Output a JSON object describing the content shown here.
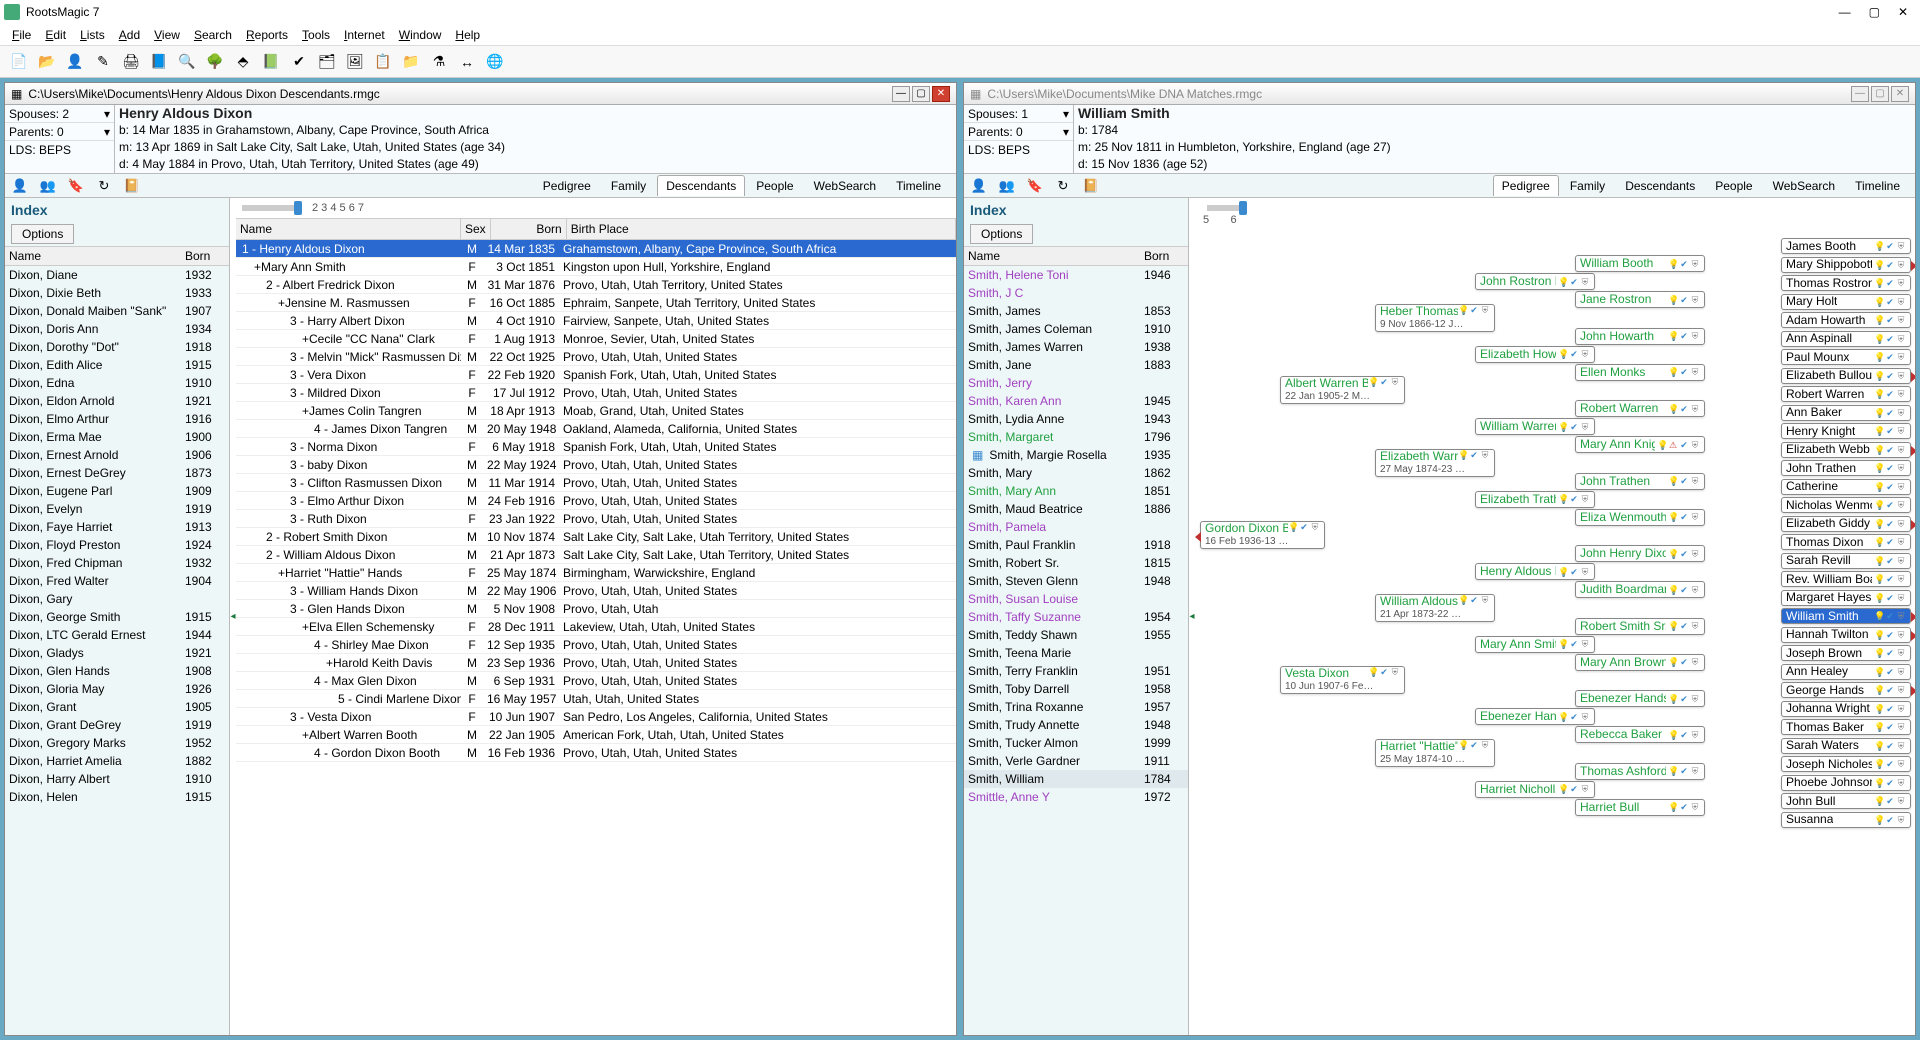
{
  "app": {
    "title": "RootsMagic 7"
  },
  "menu": [
    "File",
    "Edit",
    "Lists",
    "Add",
    "View",
    "Search",
    "Reports",
    "Tools",
    "Internet",
    "Window",
    "Help"
  ],
  "windows": [
    {
      "path": "C:\\Users\\Mike\\Documents\\Henry Aldous Dixon Descendants.rmgc",
      "active": true,
      "spouses": "Spouses: 2",
      "parents": "Parents: 0",
      "lds": "LDS: BEPS",
      "person": {
        "name": "Henry Aldous Dixon",
        "birth": "b: 14 Mar 1835 in Grahamstown, Albany, Cape Province, South Africa",
        "marriage": "m: 13 Apr 1869 in Salt Lake City, Salt Lake, Utah, United States (age 34)",
        "death": "d: 4 May 1884 in Provo, Utah, Utah Territory, United States (age 49)"
      },
      "tabs": [
        "Pedigree",
        "Family",
        "Descendants",
        "People",
        "WebSearch",
        "Timeline"
      ],
      "activeTab": "Descendants",
      "gens": "2  3  4  5  6  7",
      "indexCols": [
        "Name",
        "Born"
      ],
      "index": [
        [
          "Dixon, Diane",
          "1932"
        ],
        [
          "Dixon, Dixie Beth",
          "1933"
        ],
        [
          "Dixon, Donald Maiben \"Sank\"",
          "1907"
        ],
        [
          "Dixon, Doris Ann",
          "1934"
        ],
        [
          "Dixon, Dorothy \"Dot\"",
          "1918"
        ],
        [
          "Dixon, Edith Alice",
          "1915"
        ],
        [
          "Dixon, Edna",
          "1910"
        ],
        [
          "Dixon, Eldon Arnold",
          "1921"
        ],
        [
          "Dixon, Elmo Arthur",
          "1916"
        ],
        [
          "Dixon, Erma Mae",
          "1900"
        ],
        [
          "Dixon, Ernest Arnold",
          "1906"
        ],
        [
          "Dixon, Ernest DeGrey",
          "1873"
        ],
        [
          "Dixon, Eugene Parl",
          "1909"
        ],
        [
          "Dixon, Evelyn",
          "1919"
        ],
        [
          "Dixon, Faye Harriet",
          "1913"
        ],
        [
          "Dixon, Floyd Preston",
          "1924"
        ],
        [
          "Dixon, Fred Chipman",
          "1932"
        ],
        [
          "Dixon, Fred Walter",
          "1904"
        ],
        [
          "Dixon, Gary",
          ""
        ],
        [
          "Dixon, George Smith",
          "1915"
        ],
        [
          "Dixon, LTC Gerald Ernest",
          "1944"
        ],
        [
          "Dixon, Gladys",
          "1921"
        ],
        [
          "Dixon, Glen Hands",
          "1908"
        ],
        [
          "Dixon, Gloria May",
          "1926"
        ],
        [
          "Dixon, Grant",
          "1905"
        ],
        [
          "Dixon, Grant DeGrey",
          "1919"
        ],
        [
          "Dixon, Gregory Marks",
          "1952"
        ],
        [
          "Dixon, Harriet Amelia",
          "1882"
        ],
        [
          "Dixon, Harry Albert",
          "1910"
        ],
        [
          "Dixon, Helen",
          "1915"
        ]
      ],
      "descCols": [
        "Name",
        "Sex",
        "Born",
        "Birth Place"
      ],
      "desc": [
        {
          "n": "1 - Henry Aldous Dixon",
          "s": "M",
          "b": "14 Mar 1835",
          "p": "Grahamstown, Albany, Cape Province, South Africa",
          "sel": true,
          "i": 0
        },
        {
          "n": "+Mary Ann Smith",
          "s": "F",
          "b": "3 Oct 1851",
          "p": "Kingston upon Hull, Yorkshire, England",
          "i": 1
        },
        {
          "n": "2 - Albert Fredrick Dixon",
          "s": "M",
          "b": "31 Mar 1876",
          "p": "Provo, Utah, Utah Territory, United States",
          "i": 2
        },
        {
          "n": "+Jensine M. Rasmussen",
          "s": "F",
          "b": "16 Oct 1885",
          "p": "Ephraim, Sanpete, Utah Territory, United States",
          "i": 3
        },
        {
          "n": "3 - Harry Albert Dixon",
          "s": "M",
          "b": "4 Oct 1910",
          "p": "Fairview, Sanpete, Utah, United States",
          "i": 4
        },
        {
          "n": "+Cecile \"CC Nana\" Clark",
          "s": "F",
          "b": "1 Aug 1913",
          "p": "Monroe, Sevier, Utah, United States",
          "i": 5
        },
        {
          "n": "3 - Melvin \"Mick\" Rasmussen Dixon",
          "s": "M",
          "b": "22 Oct 1925",
          "p": "Provo, Utah, Utah, United States",
          "i": 4
        },
        {
          "n": "3 - Vera Dixon",
          "s": "F",
          "b": "22 Feb 1920",
          "p": "Spanish Fork, Utah, Utah, United States",
          "i": 4
        },
        {
          "n": "3 - Mildred Dixon",
          "s": "F",
          "b": "17 Jul 1912",
          "p": "Provo, Utah, Utah, United States",
          "i": 4
        },
        {
          "n": "+James Colin Tangren",
          "s": "M",
          "b": "18 Apr 1913",
          "p": "Moab, Grand, Utah, United States",
          "i": 5
        },
        {
          "n": "4 - James Dixon Tangren",
          "s": "M",
          "b": "20 May 1948",
          "p": "Oakland, Alameda, California, United States",
          "i": 6
        },
        {
          "n": "3 - Norma Dixon",
          "s": "F",
          "b": "6 May 1918",
          "p": "Spanish Fork, Utah, Utah, United States",
          "i": 4
        },
        {
          "n": "3 - baby Dixon",
          "s": "M",
          "b": "22 May 1924",
          "p": "Provo, Utah, Utah, United States",
          "i": 4
        },
        {
          "n": "3 - Clifton Rasmussen Dixon",
          "s": "M",
          "b": "11 Mar 1914",
          "p": "Provo, Utah, Utah, United States",
          "i": 4
        },
        {
          "n": "3 - Elmo Arthur Dixon",
          "s": "M",
          "b": "24 Feb 1916",
          "p": "Provo, Utah, Utah, United States",
          "i": 4
        },
        {
          "n": "3 - Ruth Dixon",
          "s": "F",
          "b": "23 Jan 1922",
          "p": "Provo, Utah, Utah, United States",
          "i": 4
        },
        {
          "n": "2 - Robert Smith Dixon",
          "s": "M",
          "b": "10 Nov 1874",
          "p": "Salt Lake City, Salt Lake, Utah Territory, United States",
          "i": 2
        },
        {
          "n": "2 - William Aldous Dixon",
          "s": "M",
          "b": "21 Apr 1873",
          "p": "Salt Lake City, Salt Lake, Utah Territory, United States",
          "i": 2
        },
        {
          "n": "+Harriet \"Hattie\" Hands",
          "s": "F",
          "b": "25 May 1874",
          "p": "Birmingham, Warwickshire, England",
          "i": 3
        },
        {
          "n": "3 - William Hands Dixon",
          "s": "M",
          "b": "22 May 1906",
          "p": "Provo, Utah, Utah, United States",
          "i": 4
        },
        {
          "n": "3 - Glen Hands Dixon",
          "s": "M",
          "b": "5 Nov 1908",
          "p": "Provo, Utah, Utah",
          "i": 4
        },
        {
          "n": "+Elva Ellen Schemensky",
          "s": "F",
          "b": "28 Dec 1911",
          "p": "Lakeview, Utah, Utah, United States",
          "i": 5
        },
        {
          "n": "4 - Shirley Mae Dixon",
          "s": "F",
          "b": "12 Sep 1935",
          "p": "Provo, Utah, Utah, United States",
          "i": 6
        },
        {
          "n": "+Harold Keith Davis",
          "s": "M",
          "b": "23 Sep 1936",
          "p": "Provo, Utah, Utah, United States",
          "i": 7
        },
        {
          "n": "4 - Max Glen Dixon",
          "s": "M",
          "b": "6 Sep 1931",
          "p": "Provo, Utah, Utah, United States",
          "i": 6
        },
        {
          "n": "5 - Cindi Marlene Dixon",
          "s": "F",
          "b": "16 May 1957",
          "p": "Utah, Utah, United States",
          "i": 8
        },
        {
          "n": "3 - Vesta Dixon",
          "s": "F",
          "b": "10 Jun 1907",
          "p": "San Pedro, Los Angeles, California, United States",
          "i": 4
        },
        {
          "n": "+Albert Warren Booth",
          "s": "M",
          "b": "22 Jan 1905",
          "p": "American Fork, Utah, Utah, United States",
          "i": 5
        },
        {
          "n": "4 - Gordon Dixon Booth",
          "s": "M",
          "b": "16 Feb 1936",
          "p": "Provo, Utah, Utah, United States",
          "i": 6
        }
      ]
    },
    {
      "path": "C:\\Users\\Mike\\Documents\\Mike DNA Matches.rmgc",
      "active": false,
      "spouses": "Spouses: 1",
      "parents": "Parents: 0",
      "lds": "LDS: BEPS",
      "person": {
        "name": "William Smith",
        "birth": "b: 1784",
        "marriage": "m: 25 Nov 1811 in Humbleton, Yorkshire, England (age 27)",
        "death": "d: 15 Nov 1836 (age 52)"
      },
      "tabs": [
        "Pedigree",
        "Family",
        "Descendants",
        "People",
        "WebSearch",
        "Timeline"
      ],
      "activeTab": "Pedigree",
      "gens": "5        6",
      "indexCols": [
        "Name",
        "Born"
      ],
      "index": [
        [
          "Smith, Helene Toni",
          "1946",
          "purple"
        ],
        [
          "Smith, J C",
          "",
          "purple"
        ],
        [
          "Smith, James",
          "1853"
        ],
        [
          "Smith, James Coleman",
          "1910"
        ],
        [
          "Smith, James Warren",
          "1938"
        ],
        [
          "Smith, Jane",
          "1883"
        ],
        [
          "Smith, Jerry",
          "",
          "purple"
        ],
        [
          "Smith, Karen Ann",
          "1945",
          "purple"
        ],
        [
          "Smith, Lydia Anne",
          "1943"
        ],
        [
          "Smith, Margaret",
          "1796",
          "green"
        ],
        [
          "Smith, Margie Rosella",
          "1935",
          "",
          "tree"
        ],
        [
          "Smith, Mary",
          "1862"
        ],
        [
          "Smith, Mary Ann",
          "1851",
          "green"
        ],
        [
          "Smith, Maud Beatrice",
          "1886"
        ],
        [
          "Smith, Pamela",
          "",
          "purple"
        ],
        [
          "Smith, Paul Franklin",
          "1918"
        ],
        [
          "Smith, Robert Sr.",
          "1815"
        ],
        [
          "Smith, Steven Glenn",
          "1948"
        ],
        [
          "Smith, Susan Louise",
          "",
          "purple"
        ],
        [
          "Smith, Taffy Suzanne",
          "1954",
          "purple"
        ],
        [
          "Smith, Teddy Shawn",
          "1955"
        ],
        [
          "Smith, Teena Marie",
          ""
        ],
        [
          "Smith, Terry Franklin",
          "1951"
        ],
        [
          "Smith, Toby Darrell",
          "1958"
        ],
        [
          "Smith, Trina Roxanne",
          "1957"
        ],
        [
          "Smith, Trudy Annette",
          "1948"
        ],
        [
          "Smith, Tucker Almon",
          "1999"
        ],
        [
          "Smith, Verle Gardner",
          "1911"
        ],
        [
          "Smith, William",
          "1784",
          "",
          "hl"
        ],
        [
          "Smittle, Anne Y",
          "1972",
          "purple"
        ]
      ],
      "pedigree": {
        "c0": [
          {
            "n": "Gordon Dixon Booth",
            "d": "16 Feb 1936-13 …",
            "c": "green",
            "tall": 1
          }
        ],
        "c1": [
          {
            "n": "Albert Warren Booth",
            "d": "22 Jan 1905-2 M…",
            "c": "green",
            "tall": 1
          },
          {
            "n": "Vesta Dixon",
            "d": "10 Jun 1907-6 Fe…",
            "c": "green",
            "tall": 1
          }
        ],
        "c2": [
          {
            "n": "Heber Thomas Booth",
            "d": "9 Nov 1866-12 J…",
            "c": "green",
            "tall": 1
          },
          {
            "n": "Elizabeth Warren",
            "d": "27 May 1874-23 …",
            "c": "green",
            "tall": 1
          },
          {
            "n": "William Aldous Dixon",
            "d": "21 Apr 1873-22 …",
            "c": "green",
            "tall": 1
          },
          {
            "n": "Harriet \"Hattie\" Hands",
            "d": "25 May 1874-10 …",
            "c": "green",
            "tall": 1
          }
        ],
        "c3": [
          {
            "n": "John Rostron Booth",
            "c": "green"
          },
          {
            "n": "Elizabeth Howarth",
            "c": "green"
          },
          {
            "n": "William Warren",
            "c": "green"
          },
          {
            "n": "Elizabeth Trathen",
            "c": "green"
          },
          {
            "n": "Henry Aldous Dixon",
            "c": "green"
          },
          {
            "n": "Mary Ann Smith",
            "c": "green"
          },
          {
            "n": "Ebenezer Hands",
            "c": "green"
          },
          {
            "n": "Harriet Nicholls",
            "c": "green"
          }
        ],
        "c4": [
          {
            "n": "William Booth",
            "c": "green"
          },
          {
            "n": "Jane Rostron",
            "c": "green"
          },
          {
            "n": "John Howarth",
            "c": "green"
          },
          {
            "n": "Ellen Monks",
            "c": "green"
          },
          {
            "n": "Robert Warren",
            "c": "green"
          },
          {
            "n": "Mary Ann Knight",
            "c": "green",
            "warn": 1
          },
          {
            "n": "John Trathen",
            "c": "green"
          },
          {
            "n": "Eliza Wenmouth",
            "c": "green"
          },
          {
            "n": "John Henry Dixon",
            "c": "green"
          },
          {
            "n": "Judith Boardman",
            "c": "green"
          },
          {
            "n": "Robert Smith Sr.",
            "c": "green"
          },
          {
            "n": "Mary Ann Brown",
            "c": "green"
          },
          {
            "n": "Ebenezer Hands",
            "c": "green"
          },
          {
            "n": "Rebecca Baker",
            "c": "green"
          },
          {
            "n": "Thomas Ashford Nicholls",
            "c": "green"
          },
          {
            "n": "Harriet Bull",
            "c": "green"
          }
        ],
        "c5": [
          {
            "n": "James Booth"
          },
          {
            "n": "Mary Shippobottom"
          },
          {
            "n": "Thomas Rostron"
          },
          {
            "n": "Mary Holt"
          },
          {
            "n": "Adam Howarth"
          },
          {
            "n": "Ann Aspinall"
          },
          {
            "n": "Paul Mounx"
          },
          {
            "n": "Elizabeth Bullough"
          },
          {
            "n": "Robert Warren"
          },
          {
            "n": "Ann Baker"
          },
          {
            "n": "Henry Knight"
          },
          {
            "n": "Elizabeth Webb"
          },
          {
            "n": "John Trathen"
          },
          {
            "n": "Catherine"
          },
          {
            "n": "Nicholas Wenmouth"
          },
          {
            "n": "Elizabeth Giddy"
          },
          {
            "n": "Thomas Dixon"
          },
          {
            "n": "Sarah Revill"
          },
          {
            "n": "Rev. William Boardman"
          },
          {
            "n": "Margaret Hayes"
          },
          {
            "n": "William Smith",
            "sel": 1
          },
          {
            "n": "Hannah Twilton"
          },
          {
            "n": "Joseph Brown"
          },
          {
            "n": "Ann Healey"
          },
          {
            "n": "George Hands"
          },
          {
            "n": "Johanna Wright"
          },
          {
            "n": "Thomas Baker"
          },
          {
            "n": "Sarah Waters"
          },
          {
            "n": "Joseph Nicholes"
          },
          {
            "n": "Phoebe Johnson"
          },
          {
            "n": "John Bull"
          },
          {
            "n": "Susanna"
          }
        ]
      }
    }
  ]
}
